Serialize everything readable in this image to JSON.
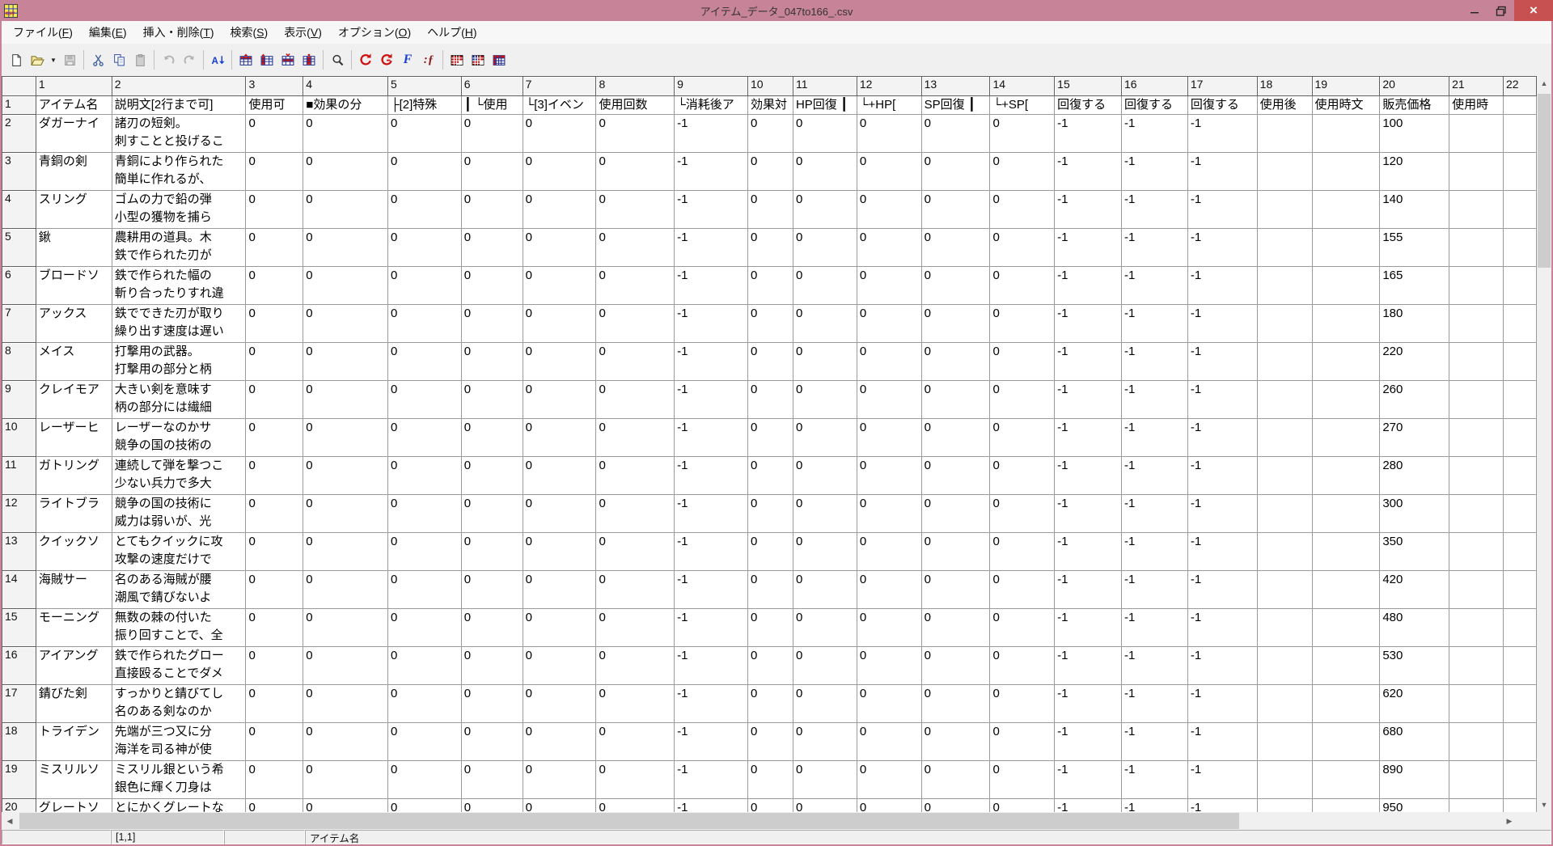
{
  "window": {
    "title": "アイテム_データ_047to166_.csv"
  },
  "titlebar": {
    "buttons": [
      "minimize",
      "restore",
      "close"
    ]
  },
  "menubar": {
    "items": [
      {
        "name": "file",
        "label": "ファイル(F)"
      },
      {
        "name": "edit",
        "label": "編集(E)"
      },
      {
        "name": "insert-delete",
        "label": "挿入・削除(T)"
      },
      {
        "name": "search",
        "label": "検索(S)"
      },
      {
        "name": "view",
        "label": "表示(V)"
      },
      {
        "name": "options",
        "label": "オプション(O)"
      },
      {
        "name": "help",
        "label": "ヘルプ(H)"
      }
    ]
  },
  "toolbar": {
    "icons": [
      "new-file",
      "open-file",
      "open-dropdown",
      "save",
      "cut",
      "copy",
      "paste",
      "undo",
      "redo",
      "sort-ascending",
      "insert-row",
      "insert-column",
      "delete-row",
      "delete-column",
      "find",
      "reload-c",
      "reload-g",
      "format-f",
      "function-fx",
      "grid-style-red",
      "grid-style-blue",
      "grid-style-header"
    ],
    "disabled": [
      "save",
      "paste",
      "undo",
      "redo"
    ]
  },
  "colors": {
    "titlebar": "#c78398",
    "close_button": "#c75050",
    "toolbar_red": "#cc1111",
    "toolbar_blue": "#1a3fd4"
  },
  "grid": {
    "columns": [
      "1",
      "2",
      "3",
      "4",
      "5",
      "6",
      "7",
      "8",
      "9",
      "10",
      "11",
      "12",
      "13",
      "14",
      "15",
      "16",
      "17",
      "18",
      "19",
      "20",
      "21",
      "22"
    ],
    "rows": [
      {
        "num": "1",
        "cells": [
          "アイテム名",
          "説明文[2行まで可]",
          "使用可",
          "■効果の分",
          "├[2]特殊",
          "┃ └使用",
          "└[3]イベン",
          "使用回数",
          "└消耗後ア",
          "効果対",
          "HP回復 ┃",
          "└+HP[",
          "SP回復 ┃",
          "└+SP[",
          "回復する",
          "回復する",
          "回復する",
          "使用後",
          "使用時文",
          "販売価格",
          "使用時",
          ""
        ]
      },
      {
        "num": "2",
        "cells": [
          "ダガーナイ",
          "諸刃の短剣。\n刺すことと投げるこ",
          "0",
          "0",
          "0",
          "0",
          "0",
          "0",
          "-1",
          "0",
          "0",
          "0",
          "0",
          "0",
          "-1",
          "-1",
          "-1",
          "",
          "",
          "100",
          "",
          ""
        ]
      },
      {
        "num": "3",
        "cells": [
          "青銅の剣",
          "青銅により作られた\n簡単に作れるが、",
          "0",
          "0",
          "0",
          "0",
          "0",
          "0",
          "-1",
          "0",
          "0",
          "0",
          "0",
          "0",
          "-1",
          "-1",
          "-1",
          "",
          "",
          "120",
          "",
          ""
        ]
      },
      {
        "num": "4",
        "cells": [
          "スリング",
          "ゴムの力で鉛の弾\n小型の獲物を捕ら",
          "0",
          "0",
          "0",
          "0",
          "0",
          "0",
          "-1",
          "0",
          "0",
          "0",
          "0",
          "0",
          "-1",
          "-1",
          "-1",
          "",
          "",
          "140",
          "",
          ""
        ]
      },
      {
        "num": "5",
        "cells": [
          "鍬",
          "農耕用の道具。木\n鉄で作られた刃が",
          "0",
          "0",
          "0",
          "0",
          "0",
          "0",
          "-1",
          "0",
          "0",
          "0",
          "0",
          "0",
          "-1",
          "-1",
          "-1",
          "",
          "",
          "155",
          "",
          ""
        ]
      },
      {
        "num": "6",
        "cells": [
          "ブロードソ",
          "鉄で作られた幅の\n斬り合ったりすれ違",
          "0",
          "0",
          "0",
          "0",
          "0",
          "0",
          "-1",
          "0",
          "0",
          "0",
          "0",
          "0",
          "-1",
          "-1",
          "-1",
          "",
          "",
          "165",
          "",
          ""
        ]
      },
      {
        "num": "7",
        "cells": [
          "アックス",
          "鉄でできた刃が取り\n繰り出す速度は遅い",
          "0",
          "0",
          "0",
          "0",
          "0",
          "0",
          "-1",
          "0",
          "0",
          "0",
          "0",
          "0",
          "-1",
          "-1",
          "-1",
          "",
          "",
          "180",
          "",
          ""
        ]
      },
      {
        "num": "8",
        "cells": [
          "メイス",
          "打撃用の武器。\n打撃用の部分と柄",
          "0",
          "0",
          "0",
          "0",
          "0",
          "0",
          "-1",
          "0",
          "0",
          "0",
          "0",
          "0",
          "-1",
          "-1",
          "-1",
          "",
          "",
          "220",
          "",
          ""
        ]
      },
      {
        "num": "9",
        "cells": [
          "クレイモア",
          "大きい剣を意味す\n柄の部分には繊細",
          "0",
          "0",
          "0",
          "0",
          "0",
          "0",
          "-1",
          "0",
          "0",
          "0",
          "0",
          "0",
          "-1",
          "-1",
          "-1",
          "",
          "",
          "260",
          "",
          ""
        ]
      },
      {
        "num": "10",
        "cells": [
          "レーザーヒ",
          "レーザーなのかサ\n競争の国の技術の",
          "0",
          "0",
          "0",
          "0",
          "0",
          "0",
          "-1",
          "0",
          "0",
          "0",
          "0",
          "0",
          "-1",
          "-1",
          "-1",
          "",
          "",
          "270",
          "",
          ""
        ]
      },
      {
        "num": "11",
        "cells": [
          "ガトリング",
          "連続して弾を撃つこ\n少ない兵力で多大",
          "0",
          "0",
          "0",
          "0",
          "0",
          "0",
          "-1",
          "0",
          "0",
          "0",
          "0",
          "0",
          "-1",
          "-1",
          "-1",
          "",
          "",
          "280",
          "",
          ""
        ]
      },
      {
        "num": "12",
        "cells": [
          "ライトブラ",
          "競争の国の技術に\n威力は弱いが、光",
          "0",
          "0",
          "0",
          "0",
          "0",
          "0",
          "-1",
          "0",
          "0",
          "0",
          "0",
          "0",
          "-1",
          "-1",
          "-1",
          "",
          "",
          "300",
          "",
          ""
        ]
      },
      {
        "num": "13",
        "cells": [
          "クイックソ",
          "とてもクイックに攻\n攻撃の速度だけで",
          "0",
          "0",
          "0",
          "0",
          "0",
          "0",
          "-1",
          "0",
          "0",
          "0",
          "0",
          "0",
          "-1",
          "-1",
          "-1",
          "",
          "",
          "350",
          "",
          ""
        ]
      },
      {
        "num": "14",
        "cells": [
          "海賊サー",
          "名のある海賊が腰\n潮風で錆びないよ",
          "0",
          "0",
          "0",
          "0",
          "0",
          "0",
          "-1",
          "0",
          "0",
          "0",
          "0",
          "0",
          "-1",
          "-1",
          "-1",
          "",
          "",
          "420",
          "",
          ""
        ]
      },
      {
        "num": "15",
        "cells": [
          "モーニング",
          "無数の棘の付いた\n振り回すことで、全",
          "0",
          "0",
          "0",
          "0",
          "0",
          "0",
          "-1",
          "0",
          "0",
          "0",
          "0",
          "0",
          "-1",
          "-1",
          "-1",
          "",
          "",
          "480",
          "",
          ""
        ]
      },
      {
        "num": "16",
        "cells": [
          "アイアング",
          "鉄で作られたグロー\n直接殴ることでダメ",
          "0",
          "0",
          "0",
          "0",
          "0",
          "0",
          "-1",
          "0",
          "0",
          "0",
          "0",
          "0",
          "-1",
          "-1",
          "-1",
          "",
          "",
          "530",
          "",
          ""
        ]
      },
      {
        "num": "17",
        "cells": [
          "錆びた剣",
          "すっかりと錆びてし\n名のある剣なのか",
          "0",
          "0",
          "0",
          "0",
          "0",
          "0",
          "-1",
          "0",
          "0",
          "0",
          "0",
          "0",
          "-1",
          "-1",
          "-1",
          "",
          "",
          "620",
          "",
          ""
        ]
      },
      {
        "num": "18",
        "cells": [
          "トライデン",
          "先端が三つ又に分\n海洋を司る神が使",
          "0",
          "0",
          "0",
          "0",
          "0",
          "0",
          "-1",
          "0",
          "0",
          "0",
          "0",
          "0",
          "-1",
          "-1",
          "-1",
          "",
          "",
          "680",
          "",
          ""
        ]
      },
      {
        "num": "19",
        "cells": [
          "ミスリルソ",
          "ミスリル銀という希\n銀色に輝く刀身は",
          "0",
          "0",
          "0",
          "0",
          "0",
          "0",
          "-1",
          "0",
          "0",
          "0",
          "0",
          "0",
          "-1",
          "-1",
          "-1",
          "",
          "",
          "890",
          "",
          ""
        ]
      },
      {
        "num": "20",
        "cells": [
          "グレートソ",
          "とにかくグレートな",
          "0",
          "0",
          "0",
          "0",
          "0",
          "0",
          "-1",
          "0",
          "0",
          "0",
          "0",
          "0",
          "-1",
          "-1",
          "-1",
          "",
          "",
          "950",
          "",
          ""
        ]
      }
    ]
  },
  "status": {
    "cell_ref": "[1,1]",
    "cell_value": "アイテム名"
  }
}
